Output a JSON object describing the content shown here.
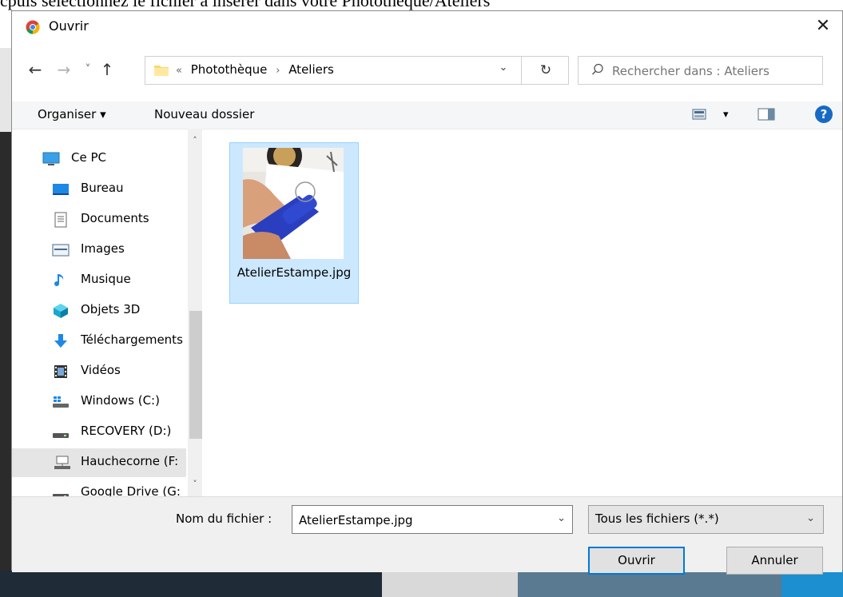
{
  "background": {
    "text": "cpuis sélectionnez le fichier à insérer dans votre Photothèque/Ateliers"
  },
  "dialog": {
    "title": "Ouvrir",
    "close_glyph": "✕"
  },
  "nav": {
    "back_glyph": "←",
    "forward_glyph": "→",
    "recent_glyph": "˅",
    "up_glyph": "↑",
    "breadcrumb_prefix": "«",
    "breadcrumb": [
      "Photothèque",
      "Ateliers"
    ],
    "breadcrumb_sep": "›",
    "dropdown_glyph": "⌄",
    "refresh_glyph": "↻",
    "search_placeholder": "Rechercher dans : Ateliers",
    "search_glyph": "⚲"
  },
  "toolbar": {
    "organize_label": "Organiser ▾",
    "new_folder_label": "Nouveau dossier",
    "view_glyph": "▾",
    "help_glyph": "?"
  },
  "sidebar": {
    "items": [
      {
        "label": "Ce PC",
        "icon": "pc-icon"
      },
      {
        "label": "Bureau",
        "icon": "desktop-icon"
      },
      {
        "label": "Documents",
        "icon": "documents-icon"
      },
      {
        "label": "Images",
        "icon": "images-icon"
      },
      {
        "label": "Musique",
        "icon": "music-icon"
      },
      {
        "label": "Objets 3D",
        "icon": "objects-3d-icon"
      },
      {
        "label": "Téléchargements",
        "icon": "download-icon"
      },
      {
        "label": "Vidéos",
        "icon": "videos-icon"
      },
      {
        "label": "Windows (C:)",
        "icon": "windows-drive-icon"
      },
      {
        "label": "RECOVERY (D:)",
        "icon": "drive-icon"
      },
      {
        "label": "Hauchecorne (F:",
        "icon": "network-drive-icon"
      },
      {
        "label": "Google Drive (G:",
        "icon": "drive-icon"
      }
    ],
    "scroll_up_glyph": "˄",
    "scroll_down_glyph": "˅"
  },
  "files": [
    {
      "name": "AtelierEstampe.jpg",
      "selected": true
    }
  ],
  "bottom": {
    "filename_label": "Nom du fichier :",
    "filename_value": "AtelierEstampe.jpg",
    "filetype_value": "Tous les fichiers (*.*)",
    "chevron_glyph": "⌄",
    "open_label": "Ouvrir",
    "cancel_label": "Annuler"
  },
  "colors": {
    "selection_bg": "#cce8ff",
    "selection_border": "#99d1ff",
    "accent": "#0078d7",
    "help": "#1769c4"
  }
}
